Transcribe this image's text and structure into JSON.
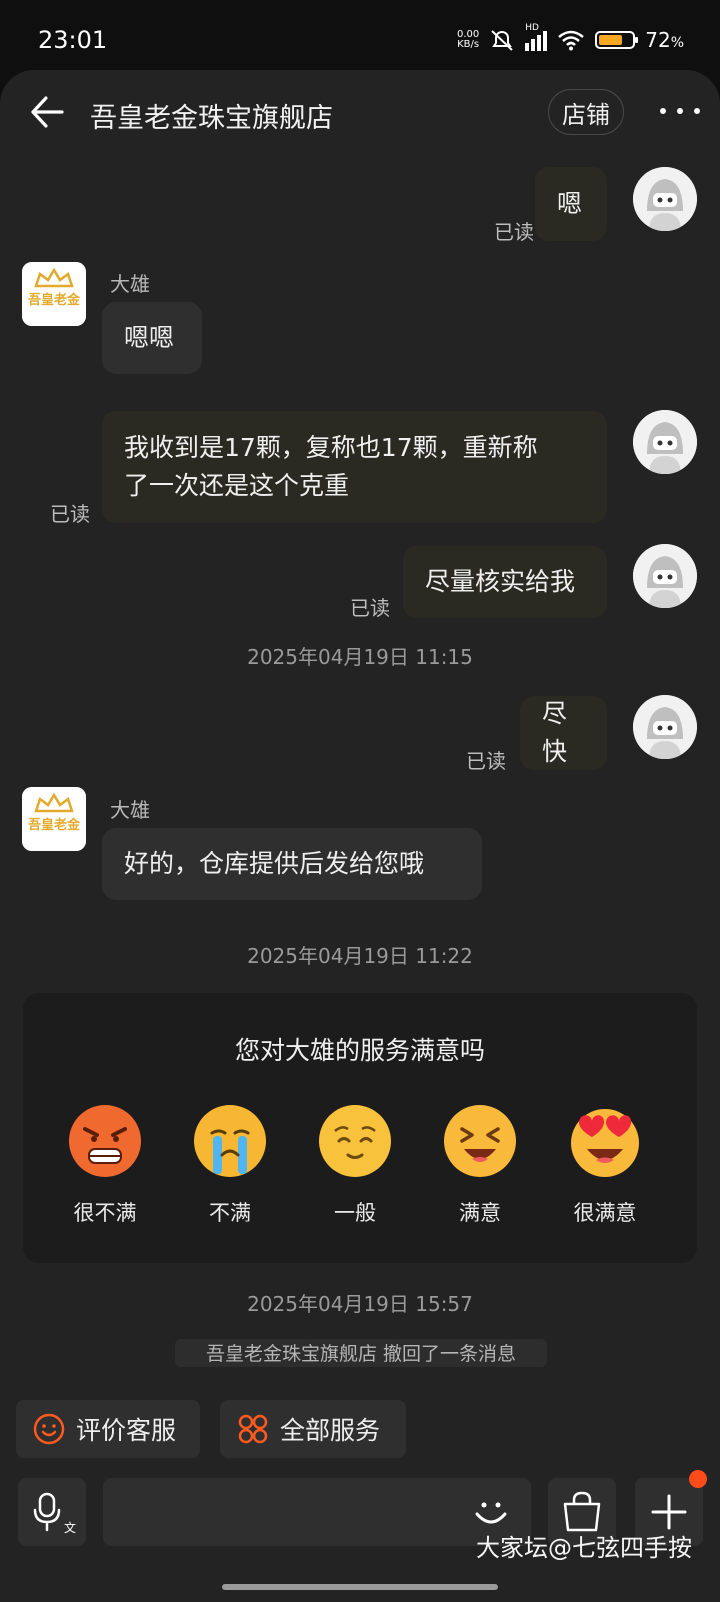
{
  "status_bar": {
    "time": "23:01",
    "net_speed_top": "0.00",
    "net_speed_bottom": "KB/s",
    "network": "HD",
    "battery_percent": "72",
    "battery_suffix": "%",
    "battery_level": 0.72
  },
  "header": {
    "title": "吾皇老金珠宝旗舰店",
    "shop_button": "店铺"
  },
  "messages": [
    {
      "from": "me",
      "text": "嗯",
      "status": "已读"
    },
    {
      "from": "shop",
      "sender": "大雄",
      "text": "嗯嗯",
      "logo_text": "吾皇老金"
    },
    {
      "from": "me",
      "line1": "我收到是17颗，复称也17颗，重新称",
      "line2": "了一次还是这个克重",
      "status": "已读"
    },
    {
      "from": "me",
      "text": "尽量核实给我",
      "status": "已读"
    },
    {
      "from": "me",
      "text": "尽快",
      "status": "已读"
    },
    {
      "from": "shop",
      "sender": "大雄",
      "text": "好的，仓库提供后发给您哦",
      "logo_text": "吾皇老金"
    }
  ],
  "timestamps": [
    "2025年04月19日 11:15",
    "2025年04月19日 11:22",
    "2025年04月19日 15:57"
  ],
  "rating_card": {
    "title": "您对大雄的服务满意吗",
    "options": [
      {
        "label": "很不满",
        "icon": "angry-face-icon"
      },
      {
        "label": "不满",
        "icon": "crying-face-icon"
      },
      {
        "label": "一般",
        "icon": "neutral-face-icon"
      },
      {
        "label": "满意",
        "icon": "laughing-face-icon"
      },
      {
        "label": "很满意",
        "icon": "heart-eyes-face-icon"
      }
    ]
  },
  "recall_notice": "吾皇老金珠宝旗舰店 撤回了一条消息",
  "quick_actions": {
    "rate_service": "评价客服",
    "all_services": "全部服务"
  },
  "watermark": "大家坛@七弦四手按",
  "colors": {
    "accent": "#ff5a1f",
    "panel": "#232323",
    "bubble": "#2f2f2f",
    "logo_gold": "#e3a92b"
  }
}
